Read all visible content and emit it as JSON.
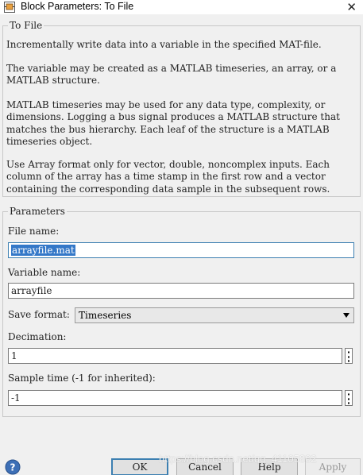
{
  "window": {
    "title": "Block Parameters: To File",
    "close_glyph": "✕",
    "app_icon": "simulink-block-icon"
  },
  "description": {
    "group_label": "To File",
    "paragraphs": [
      "Incrementally write data into a variable in the specified MAT-file.",
      "The variable may be created as a MATLAB timeseries, an array, or a MATLAB structure.",
      "MATLAB timeseries may be used for any data type, complexity, or dimensions. Logging a bus signal produces a MATLAB structure that matches the bus hierarchy. Each leaf of the structure is a MATLAB timeseries object.",
      "Use Array format only for vector, double, noncomplex inputs. Each column of the array has a time stamp in the first row and a vector containing the corresponding data sample in the subsequent rows."
    ]
  },
  "parameters": {
    "group_label": "Parameters",
    "file_name": {
      "label": "File name:",
      "value": "arrayfile.mat"
    },
    "variable_name": {
      "label": "Variable name:",
      "value": "arrayfile"
    },
    "save_format": {
      "label": "Save format:",
      "value": "Timeseries"
    },
    "decimation": {
      "label": "Decimation:",
      "value": "1"
    },
    "sample_time": {
      "label": "Sample time (-1 for inherited):",
      "value": "-1"
    }
  },
  "buttons": {
    "ok": "OK",
    "cancel": "Cancel",
    "help": "Help",
    "apply": "Apply"
  },
  "watermark": "https://blog.csdn.net/qq_41105802",
  "colors": {
    "selection": "#3478c8",
    "focus_border": "#3c7fb1",
    "background": "#f0f0f0"
  }
}
